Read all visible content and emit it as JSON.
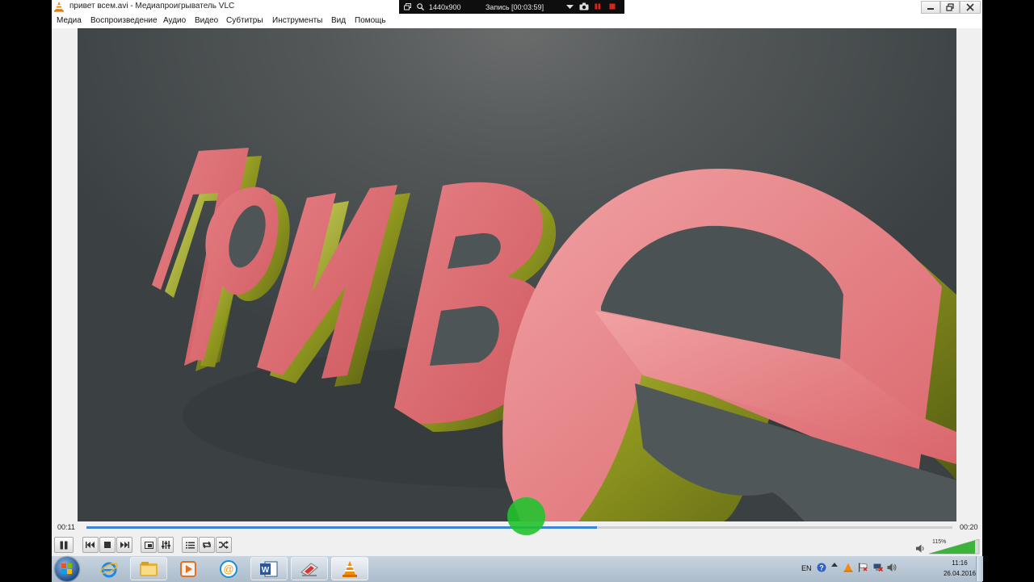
{
  "window": {
    "title": "привет всем.avi - Медиапроигрыватель VLC"
  },
  "recorder": {
    "resolution": "1440x900",
    "recording_label": "Запись [00:03:59]"
  },
  "menu": {
    "items": [
      "Медиа",
      "Воспроизведение",
      "Аудио",
      "Видео",
      "Субтитры",
      "Инструменты",
      "Вид",
      "Помощь"
    ]
  },
  "player": {
    "time_elapsed": "00:11",
    "time_total": "00:20",
    "progress_fraction": 0.59,
    "volume_label": "115%",
    "volume_fraction": 0.92
  },
  "taskbar": {
    "language": "EN",
    "clock_time": "11:16",
    "clock_date": "26.04.2016"
  },
  "colors": {
    "seek_fill": "#3d84d6",
    "cursor_highlight": "#22c22e",
    "vlc_orange": "#f58b00",
    "letter_face": "#d9656b",
    "letter_side": "#b8c13a"
  }
}
